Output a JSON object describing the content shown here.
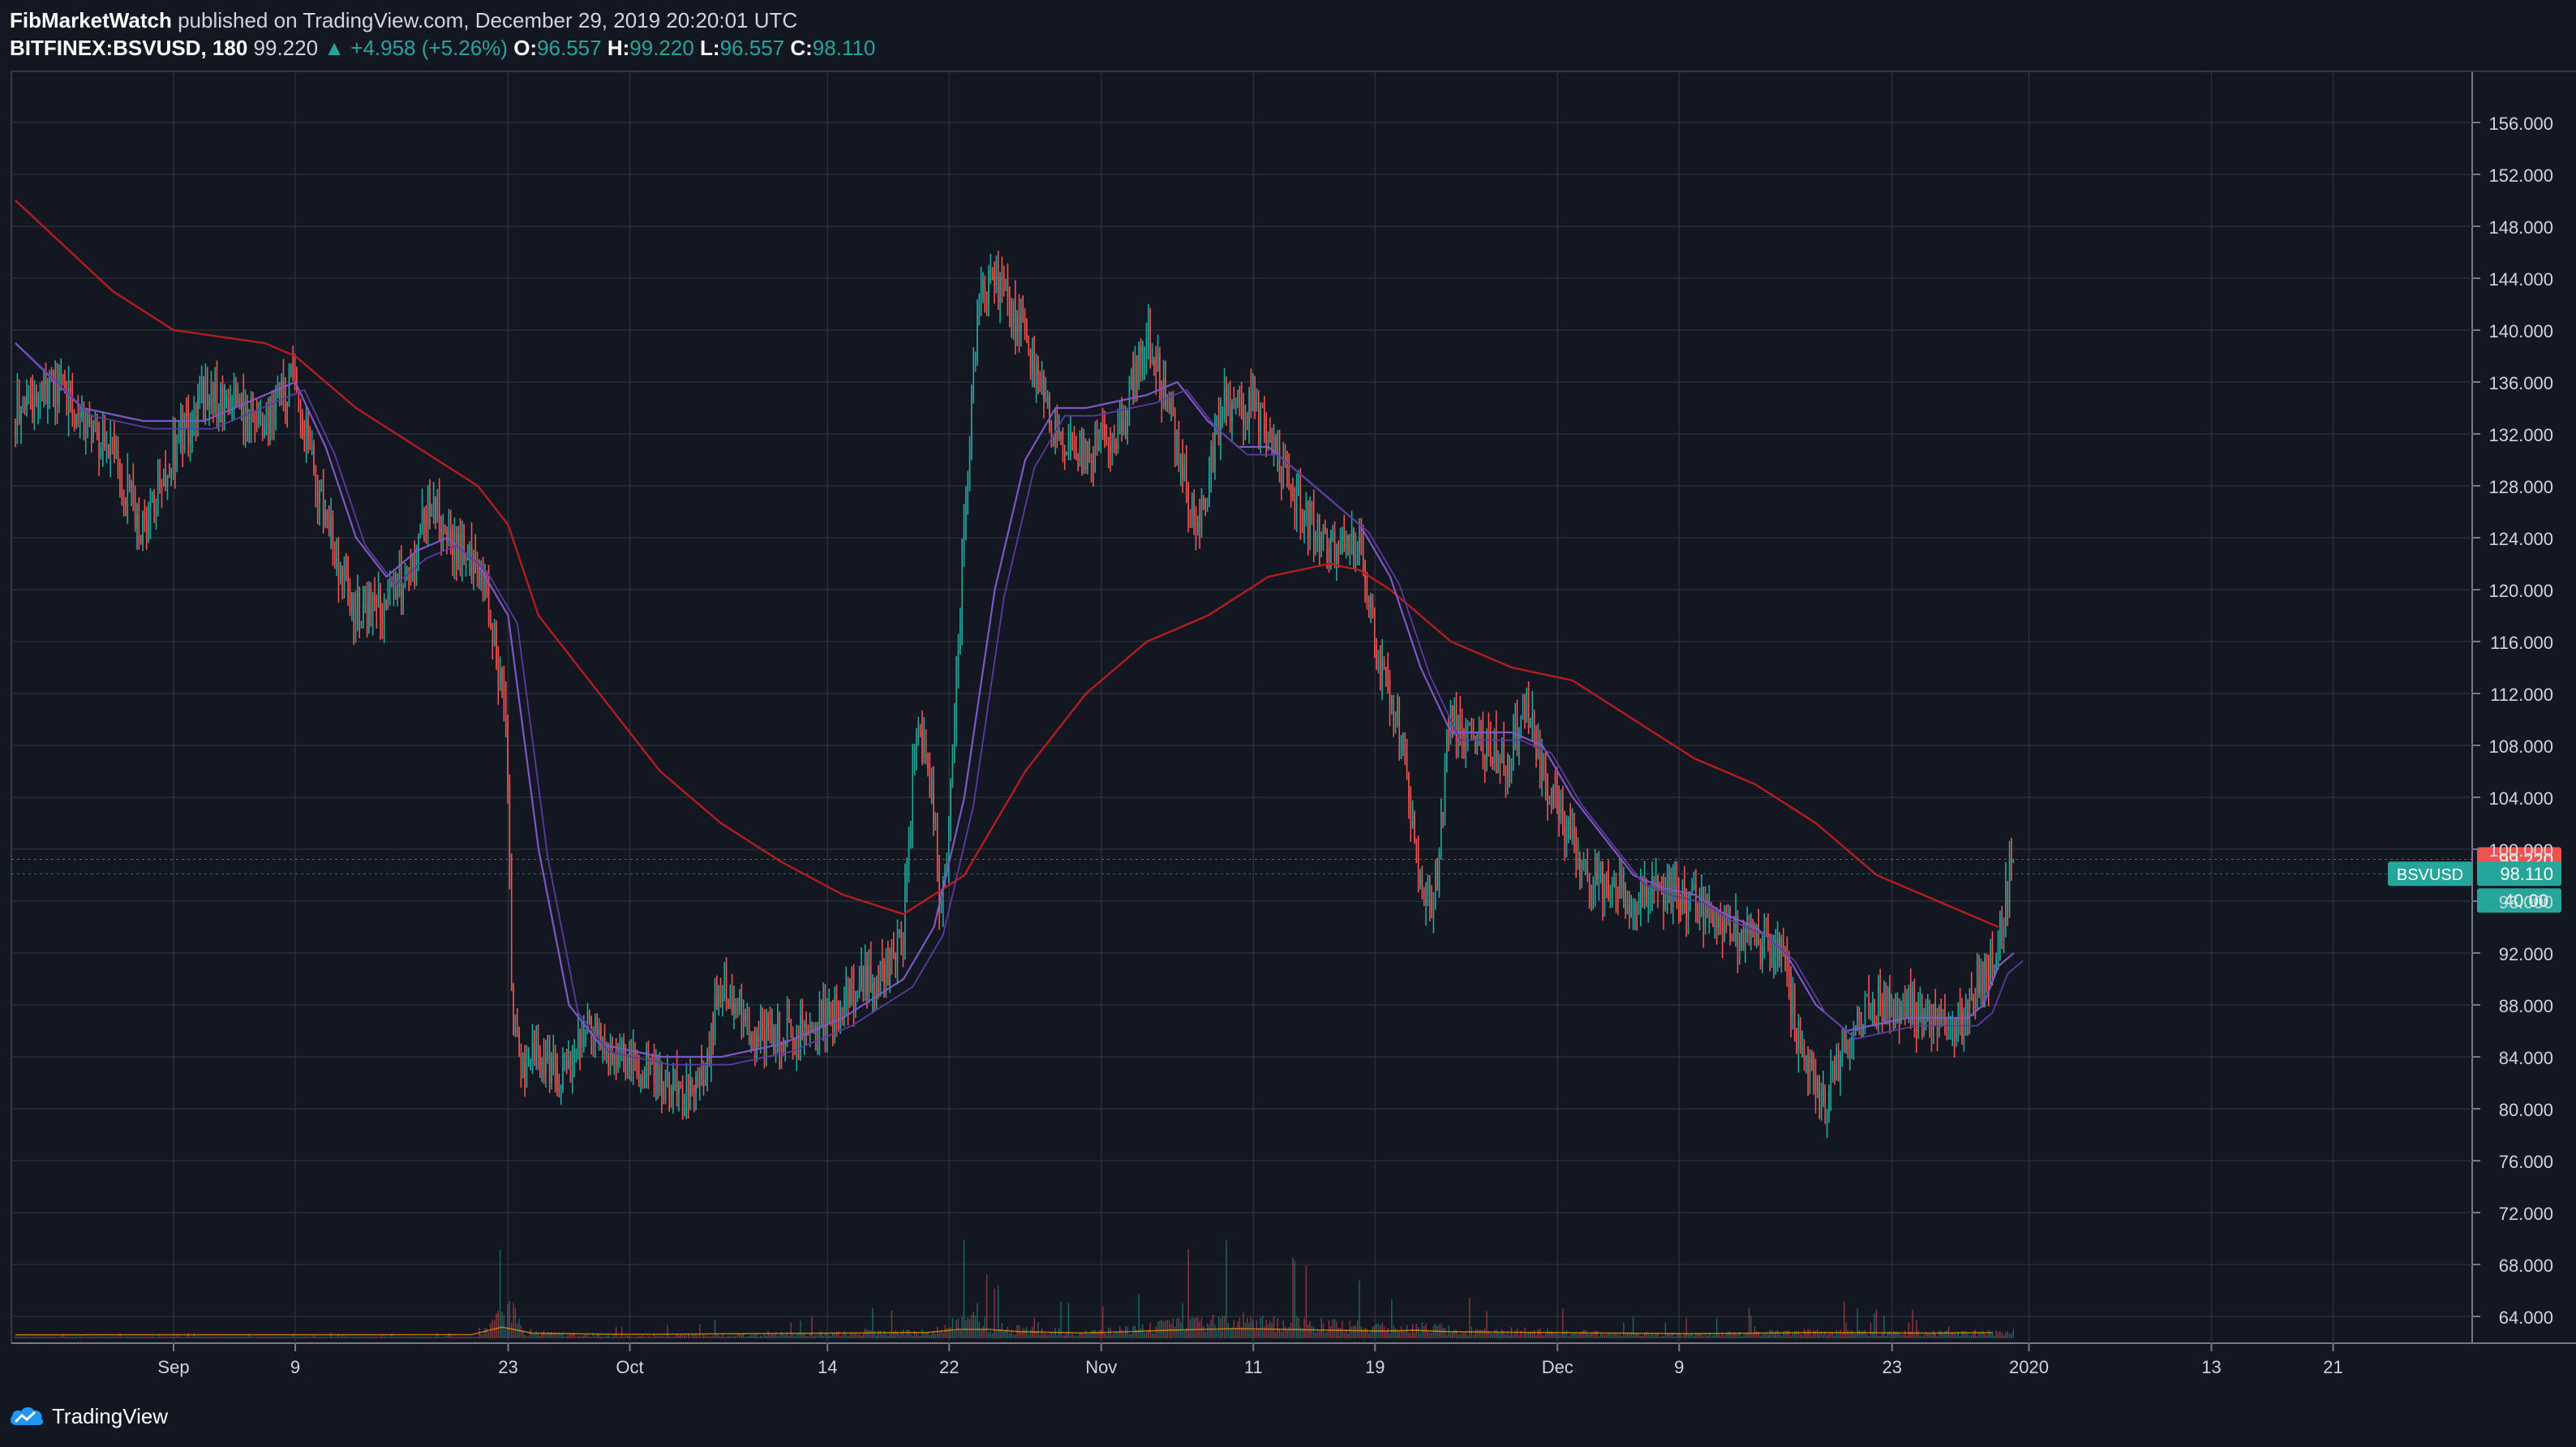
{
  "header": {
    "author": "FibMarketWatch",
    "published": "published on TradingView.com, December 29, 2019 20:20:01 UTC"
  },
  "symbol_line": {
    "symbol": "BITFINEX:BSVUSD, 180",
    "last": "99.220",
    "change": "▲ +4.958 (+5.26%)",
    "o_label": "O:",
    "o_value": "96.557",
    "h_label": "H:",
    "h_value": "99.220",
    "l_label": "L:",
    "l_value": "96.557",
    "c_label": "C:",
    "c_value": "98.110"
  },
  "footer": {
    "brand": "TradingView"
  },
  "colors": {
    "background": "#131722",
    "grid": "#2a2e39",
    "up": "#26a69a",
    "down": "#ef5350",
    "ma_slow": "#b71c1c",
    "ma_fast": "#7e57c2",
    "ma_fast2": "#5c3a9e",
    "axis_text": "#d1d4dc"
  },
  "chart_data": {
    "type": "candlestick",
    "title": "",
    "ylim": [
      60,
      158
    ],
    "y_ticks": [
      "156.000",
      "152.000",
      "148.000",
      "144.000",
      "140.000",
      "136.000",
      "132.000",
      "128.000",
      "124.000",
      "120.000",
      "116.000",
      "112.000",
      "108.000",
      "104.000",
      "100.000",
      "96.000",
      "92.000",
      "88.000",
      "84.000",
      "80.000",
      "76.000",
      "72.000",
      "68.000",
      "64.000"
    ],
    "x_ticks": [
      {
        "label": "Sep",
        "day": 0
      },
      {
        "label": "9",
        "day": 8
      },
      {
        "label": "23",
        "day": 22
      },
      {
        "label": "Oct",
        "day": 30
      },
      {
        "label": "14",
        "day": 43
      },
      {
        "label": "22",
        "day": 51
      },
      {
        "label": "Nov",
        "day": 61
      },
      {
        "label": "11",
        "day": 71
      },
      {
        "label": "19",
        "day": 79
      },
      {
        "label": "Dec",
        "day": 91
      },
      {
        "label": "9",
        "day": 99
      },
      {
        "label": "23",
        "day": 113
      },
      {
        "label": "2020",
        "day": 122
      },
      {
        "label": "13",
        "day": 134
      },
      {
        "label": "21",
        "day": 142
      }
    ],
    "x_day_range": [
      -10.4,
      151
    ],
    "price_path": [
      [
        -10.4,
        133
      ],
      [
        -8,
        136
      ],
      [
        -6,
        133
      ],
      [
        -4,
        131
      ],
      [
        -2,
        125
      ],
      [
        0,
        130
      ],
      [
        2,
        135
      ],
      [
        4,
        134
      ],
      [
        6,
        133
      ],
      [
        8,
        136
      ],
      [
        10,
        126
      ],
      [
        12,
        118
      ],
      [
        14,
        119
      ],
      [
        16,
        122
      ],
      [
        17,
        128
      ],
      [
        18,
        124
      ],
      [
        20,
        122
      ],
      [
        21,
        118
      ],
      [
        22,
        110
      ],
      [
        22.4,
        86
      ],
      [
        23,
        83
      ],
      [
        24,
        84
      ],
      [
        26,
        82
      ],
      [
        27.5,
        87
      ],
      [
        29,
        84
      ],
      [
        31,
        83
      ],
      [
        33,
        82
      ],
      [
        35,
        82
      ],
      [
        36,
        90
      ],
      [
        38,
        85
      ],
      [
        40,
        86
      ],
      [
        42,
        86
      ],
      [
        44,
        88
      ],
      [
        46,
        90
      ],
      [
        48,
        92
      ],
      [
        49,
        110
      ],
      [
        50,
        105
      ],
      [
        50.5,
        95
      ],
      [
        51,
        100
      ],
      [
        52,
        122
      ],
      [
        53,
        142
      ],
      [
        54,
        144
      ],
      [
        56,
        140
      ],
      [
        58,
        132
      ],
      [
        60,
        130
      ],
      [
        61,
        132
      ],
      [
        62,
        130
      ],
      [
        64,
        140
      ],
      [
        66,
        132
      ],
      [
        67.5,
        124
      ],
      [
        69,
        134
      ],
      [
        71,
        134
      ],
      [
        72,
        132
      ],
      [
        74,
        127
      ],
      [
        76,
        123
      ],
      [
        78,
        124
      ],
      [
        79.5,
        114
      ],
      [
        81,
        108
      ],
      [
        82,
        98
      ],
      [
        83,
        95
      ],
      [
        84,
        110
      ],
      [
        86,
        108
      ],
      [
        88,
        107
      ],
      [
        89,
        112
      ],
      [
        90,
        106
      ],
      [
        91,
        104
      ],
      [
        93,
        98
      ],
      [
        95,
        97
      ],
      [
        96,
        96
      ],
      [
        98,
        97
      ],
      [
        100,
        96
      ],
      [
        102,
        94
      ],
      [
        104,
        93
      ],
      [
        106,
        92
      ],
      [
        107,
        85
      ],
      [
        108.5,
        80
      ],
      [
        110,
        85
      ],
      [
        112,
        88
      ],
      [
        114,
        88
      ],
      [
        116,
        86
      ],
      [
        118,
        87
      ],
      [
        119,
        90
      ],
      [
        120,
        92
      ],
      [
        121,
        99.2
      ]
    ],
    "ma_slow": [
      [
        -10.4,
        150
      ],
      [
        -4,
        143
      ],
      [
        0,
        140
      ],
      [
        6,
        139
      ],
      [
        8,
        138
      ],
      [
        12,
        134
      ],
      [
        16,
        131
      ],
      [
        20,
        128
      ],
      [
        22,
        125
      ],
      [
        24,
        118
      ],
      [
        28,
        112
      ],
      [
        32,
        106
      ],
      [
        36,
        102
      ],
      [
        40,
        99
      ],
      [
        44,
        96.5
      ],
      [
        48,
        95
      ],
      [
        52,
        98
      ],
      [
        56,
        106
      ],
      [
        60,
        112
      ],
      [
        64,
        116
      ],
      [
        68,
        118
      ],
      [
        72,
        121
      ],
      [
        76,
        122
      ],
      [
        78,
        121.5
      ],
      [
        80,
        120
      ],
      [
        84,
        116
      ],
      [
        88,
        114
      ],
      [
        92,
        113
      ],
      [
        96,
        110
      ],
      [
        100,
        107
      ],
      [
        104,
        105
      ],
      [
        108,
        102
      ],
      [
        112,
        98
      ],
      [
        116,
        96
      ],
      [
        120,
        94
      ]
    ],
    "ma_fast": [
      [
        -10.4,
        139
      ],
      [
        -6,
        134
      ],
      [
        -2,
        133
      ],
      [
        2,
        133
      ],
      [
        6,
        135
      ],
      [
        8,
        136
      ],
      [
        10,
        131
      ],
      [
        12,
        124
      ],
      [
        14,
        121
      ],
      [
        16,
        123
      ],
      [
        18,
        124
      ],
      [
        20,
        122
      ],
      [
        22,
        118
      ],
      [
        24,
        100
      ],
      [
        26,
        88
      ],
      [
        28,
        85
      ],
      [
        32,
        84
      ],
      [
        36,
        84
      ],
      [
        40,
        85
      ],
      [
        44,
        87
      ],
      [
        48,
        90
      ],
      [
        50,
        94
      ],
      [
        52,
        104
      ],
      [
        54,
        120
      ],
      [
        56,
        130
      ],
      [
        58,
        134
      ],
      [
        60,
        134
      ],
      [
        64,
        135
      ],
      [
        66,
        136
      ],
      [
        68,
        133
      ],
      [
        70,
        131
      ],
      [
        72,
        131
      ],
      [
        74,
        129
      ],
      [
        76,
        127
      ],
      [
        78,
        125
      ],
      [
        80,
        121
      ],
      [
        82,
        114
      ],
      [
        84,
        109
      ],
      [
        86,
        109
      ],
      [
        88,
        109
      ],
      [
        90,
        108
      ],
      [
        92,
        104
      ],
      [
        94,
        101
      ],
      [
        96,
        98
      ],
      [
        98,
        97
      ],
      [
        100,
        96.5
      ],
      [
        102,
        95
      ],
      [
        104,
        94
      ],
      [
        106,
        92
      ],
      [
        108,
        88
      ],
      [
        110,
        86
      ],
      [
        112,
        86.5
      ],
      [
        114,
        87
      ],
      [
        116,
        87
      ],
      [
        118,
        87
      ],
      [
        119,
        88
      ],
      [
        120,
        91
      ],
      [
        121,
        92
      ]
    ],
    "volume_profile": [
      [
        -10.4,
        0.02
      ],
      [
        20,
        0.03
      ],
      [
        22.4,
        0.9
      ],
      [
        23,
        0.15
      ],
      [
        30,
        0.05
      ],
      [
        50,
        0.2
      ],
      [
        52,
        0.5
      ],
      [
        53,
        0.65
      ],
      [
        54,
        0.3
      ],
      [
        60,
        0.15
      ],
      [
        66,
        0.4
      ],
      [
        70,
        0.5
      ],
      [
        80,
        0.3
      ],
      [
        81,
        0.4
      ],
      [
        84,
        0.25
      ],
      [
        100,
        0.1
      ],
      [
        108,
        0.2
      ],
      [
        116,
        0.15
      ],
      [
        121,
        0.2
      ]
    ],
    "price_tags": [
      {
        "label": "99.220",
        "value": 99.22,
        "color": "#ef5350"
      },
      {
        "label": "98.110",
        "value": 98.11,
        "color": "#26a69a",
        "name": "BSVUSD"
      }
    ],
    "countdown_tag": "40:00"
  }
}
